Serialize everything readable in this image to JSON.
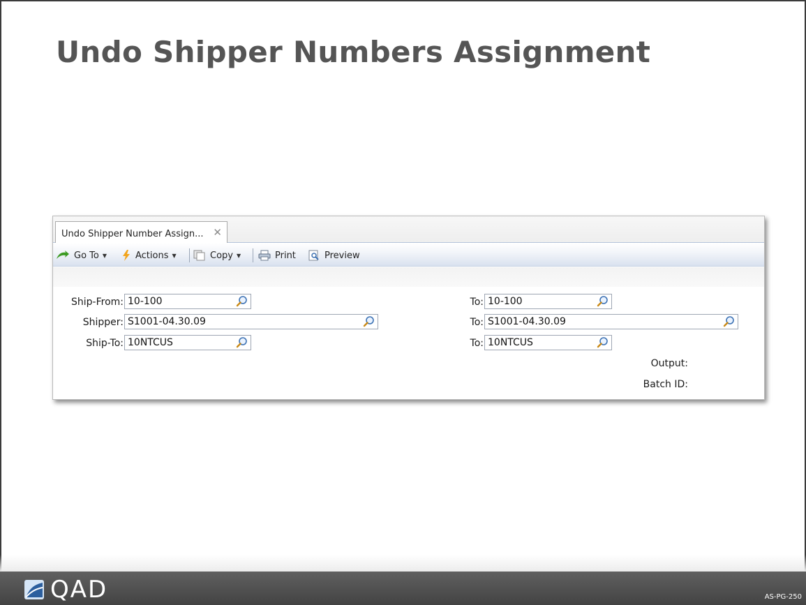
{
  "slide": {
    "title": "Undo Shipper Numbers Assignment",
    "code": "AS-PG-250",
    "brand": "QAD"
  },
  "window": {
    "tab_title": "Undo Shipper Number Assign...",
    "tab_close": "✕"
  },
  "toolbar": {
    "goto_label": "Go To",
    "actions_label": "Actions",
    "copy_label": "Copy",
    "print_label": "Print",
    "preview_label": "Preview"
  },
  "form": {
    "ship_from_label": "Ship-From:",
    "ship_from_value": "10-100",
    "ship_from_to_label": "To:",
    "ship_from_to_value": "10-100",
    "shipper_label": "Shipper:",
    "shipper_value": "S1001-04.30.09",
    "shipper_to_label": "To:",
    "shipper_to_value": "S1001-04.30.09",
    "ship_to_label": "Ship-To:",
    "ship_to_value": "10NTCUS",
    "ship_to_to_label": "To:",
    "ship_to_to_value": "10NTCUS",
    "output_label": "Output:",
    "batch_id_label": "Batch ID:"
  },
  "icons": {
    "goto": "green-arrow-icon",
    "actions": "lightning-icon",
    "copy": "copy-icon",
    "print": "printer-icon",
    "preview": "preview-icon",
    "lookup": "magnifier-icon"
  },
  "colors": {
    "title_text": "#555555",
    "footer_band": "#4a4a4a",
    "toolbar_blue": "#d9e2ef"
  }
}
